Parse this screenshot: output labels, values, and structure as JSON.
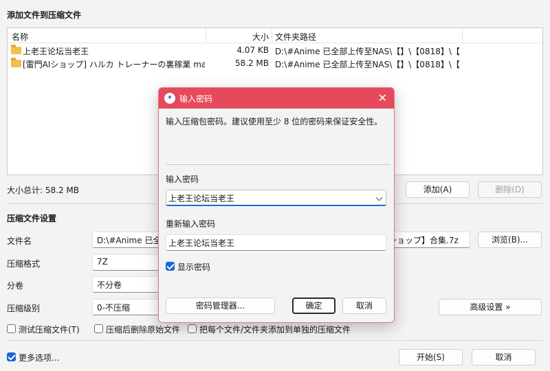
{
  "header": {
    "title": "添加文件到压缩文件"
  },
  "filelist": {
    "columns": {
      "name": "名称",
      "size": "大小",
      "path": "文件夹路径"
    },
    "rows": [
      {
        "name": "上老王论坛当老王",
        "size": "4.07 KB",
        "path": "D:\\#Anime 已全部上传至NAS\\【】\\【0818】\\【..."
      },
      {
        "name": "[雷門AIショップ] ハルカ トレーナーの裏稼業 ma...",
        "size": "58.2 MB",
        "path": "D:\\#Anime 已全部上传至NAS\\【】\\【0818】\\【..."
      }
    ]
  },
  "summary": {
    "total": "大小总计: 58.2 MB"
  },
  "actions": {
    "add": "添加(A)",
    "delete": "删除(D)"
  },
  "settings": {
    "title": "压缩文件设置",
    "filename_label": "文件名",
    "filename_value": "D:\\#Anime 已全部",
    "filename_tail": "ショップ】合集.7z",
    "browse": "浏览(B)...",
    "format_label": "压缩格式",
    "format_value": "7Z",
    "split_label": "分卷",
    "split_value": "不分卷",
    "level_label": "压缩级别",
    "level_value": "0-不压缩",
    "advanced": "高级设置 »"
  },
  "options": {
    "test": "测试压缩文件(T)",
    "delete_after": "压缩后删除原始文件",
    "separate": "把每个文件/文件夹添加到单独的压缩文件",
    "more": "更多选项..."
  },
  "footer": {
    "start": "开始(S)",
    "cancel": "取消"
  },
  "dialog": {
    "title": "输入密码",
    "description": "输入压缩包密码。建议使用至少 8 位的密码来保证安全性。",
    "password_label": "输入密码",
    "password_value": "上老王论坛当老王",
    "confirm_label": "重新输入密码",
    "confirm_value": "上老王论坛当老王",
    "show_password": "显示密码",
    "manager": "密码管理器...",
    "ok": "确定",
    "cancel": "取消"
  }
}
